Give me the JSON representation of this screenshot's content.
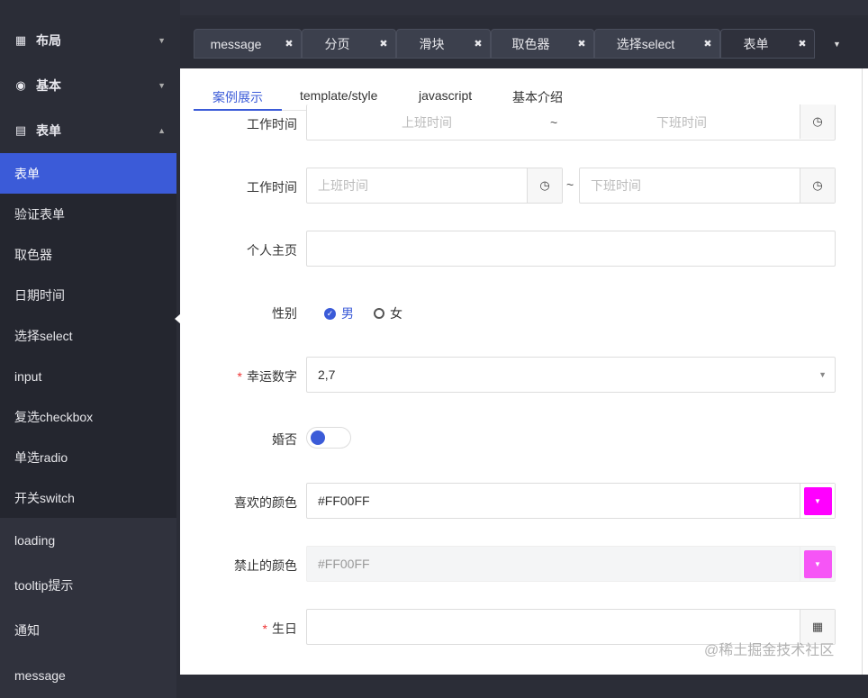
{
  "sidebar": {
    "groups": [
      {
        "label": "布局",
        "icon": "grid-icon"
      },
      {
        "label": "基本",
        "icon": "chrome-icon"
      },
      {
        "label": "表单",
        "icon": "document-icon"
      }
    ],
    "sub_items": [
      "表单",
      "验证表单",
      "取色器",
      "日期时间",
      "选择select",
      "input",
      "复选checkbox",
      "单选radio",
      "开关switch"
    ],
    "lower_items": [
      "loading",
      "tooltip提示",
      "通知",
      "message"
    ]
  },
  "tabs": [
    {
      "label": "message"
    },
    {
      "label": "分页"
    },
    {
      "label": "滑块"
    },
    {
      "label": "取色器"
    },
    {
      "label": "选择select"
    },
    {
      "label": "表单"
    }
  ],
  "subtabs": [
    "案例展示",
    "template/style",
    "javascript",
    "基本介绍"
  ],
  "form": {
    "row1": {
      "label": "工作时间",
      "start_placeholder": "上班时间",
      "sep": "~",
      "end_placeholder": "下班时间"
    },
    "row2": {
      "label": "工作时间",
      "start_placeholder": "上班时间",
      "sep": "~",
      "end_placeholder": "下班时间"
    },
    "homepage": {
      "label": "个人主页",
      "value": ""
    },
    "gender": {
      "label": "性别",
      "options": [
        "男",
        "女"
      ],
      "selected": "男"
    },
    "lucky": {
      "label": "幸运数字",
      "required": "*",
      "value": "2,7"
    },
    "married": {
      "label": "婚否",
      "on": false
    },
    "fav_color": {
      "label": "喜欢的颜色",
      "value": "#FF00FF",
      "color": "#ff00ff"
    },
    "ban_color": {
      "label": "禁止的颜色",
      "value": "#FF00FF",
      "color": "#f655f6"
    },
    "birthday": {
      "label": "生日",
      "required": "*",
      "value": ""
    }
  },
  "watermark": "@稀土掘金技术社区"
}
